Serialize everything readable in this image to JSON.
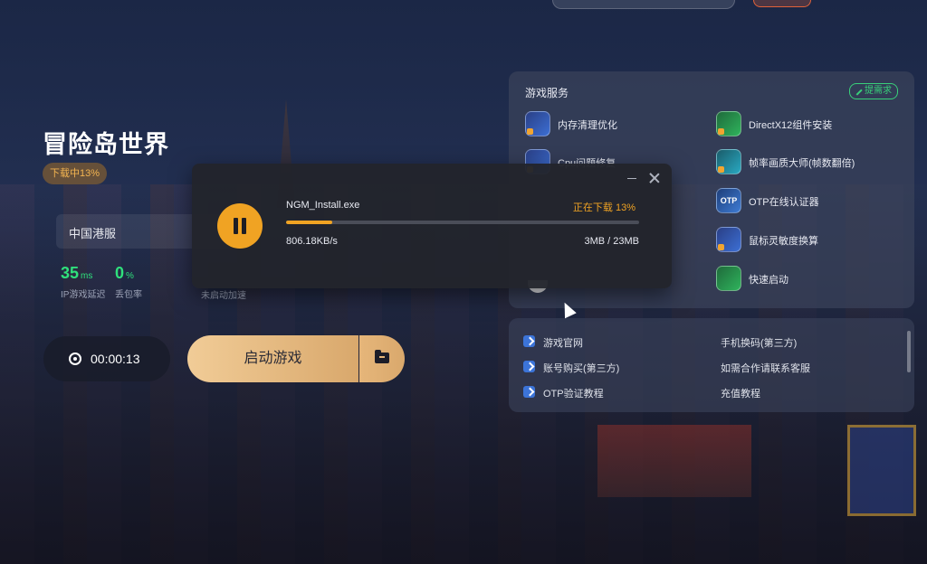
{
  "game": {
    "title": "冒险岛世界",
    "download_badge": "下载中13%",
    "server": "中国港服",
    "stats": {
      "latency_value": "35",
      "latency_unit": "ms",
      "latency_label": "IP游戏延迟",
      "loss_value": "0",
      "loss_unit": "%",
      "loss_label": "丢包率",
      "extra_label": "未启动加速"
    },
    "timer": "00:00:13",
    "start_label": "启动游戏"
  },
  "services": {
    "title": "游戏服务",
    "request_label": "提需求",
    "items": [
      {
        "label": "内存清理优化",
        "icon": "memory-clean-icon"
      },
      {
        "label": "Cpu问题修复",
        "icon": "cpu-fix-icon"
      },
      {
        "label": "DirectX12组件安装",
        "icon": "directx-icon"
      },
      {
        "label": "帧率画质大师(帧数翻倍)",
        "icon": "fps-master-icon"
      },
      {
        "label": "OTP在线认证器",
        "icon": "otp-icon"
      },
      {
        "label": "鼠标灵敏度换算",
        "icon": "mouse-sensitivity-icon"
      },
      {
        "label": "快速启动",
        "icon": "quick-launch-icon"
      }
    ]
  },
  "links": {
    "items": [
      {
        "label": "游戏官网"
      },
      {
        "label": "账号购买(第三方)"
      },
      {
        "label": "OTP验证教程"
      },
      {
        "label": "手机换码(第三方)"
      },
      {
        "label": "如需合作请联系客服"
      },
      {
        "label": "充值教程"
      }
    ]
  },
  "download": {
    "filename": "NGM_Install.exe",
    "status": "正在下载 13%",
    "progress": 0.13,
    "speed": "806.18KB/s",
    "size": "3MB / 23MB"
  },
  "colors": {
    "accent": "#f0a323",
    "green": "#2fe07c",
    "start_button": "#e6b67a"
  }
}
